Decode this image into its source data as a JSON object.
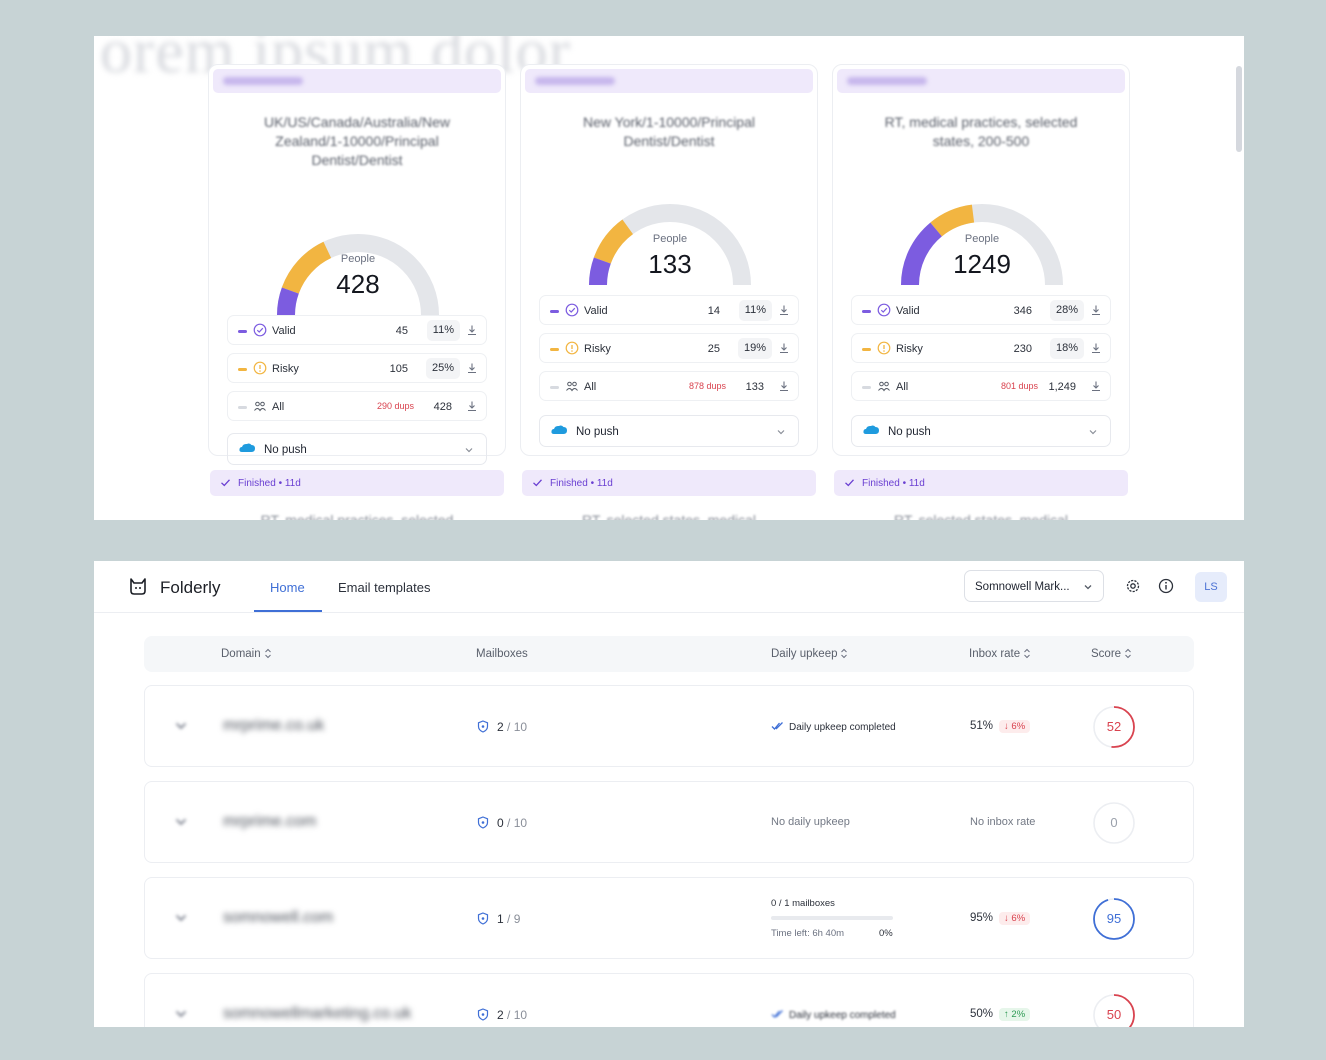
{
  "segments_panel": {
    "ghost_heading": "orem ipsum dolor",
    "cards": [
      {
        "tag": "Finished · 11d",
        "title_line1": "UK/US/Canada/Australia/New",
        "title_line2": "Zealand/1-10000/Principal",
        "title_line3": "Dentist/Dentist",
        "gauge_label": "People",
        "total": "428",
        "gauge": {
          "valid_fraction": 0.11,
          "risky_fraction": 0.25
        },
        "stats": [
          {
            "name": "Valid",
            "count": "45",
            "pct": "11%"
          },
          {
            "name": "Risky",
            "count": "105",
            "pct": "25%"
          },
          {
            "name": "All",
            "dups": "290 dups",
            "count": "428"
          }
        ],
        "push": "No push"
      },
      {
        "tag": "Finished · 11d",
        "title_line1": "New York/1-10000/Principal",
        "title_line2": "Dentist/Dentist",
        "gauge_label": "People",
        "total": "133",
        "gauge": {
          "valid_fraction": 0.11,
          "risky_fraction": 0.19
        },
        "stats": [
          {
            "name": "Valid",
            "count": "14",
            "pct": "11%"
          },
          {
            "name": "Risky",
            "count": "25",
            "pct": "19%"
          },
          {
            "name": "All",
            "dups": "878 dups",
            "count": "133"
          }
        ],
        "push": "No push"
      },
      {
        "tag": "Finished · 11d",
        "title_line1": "RT, medical practices, selected",
        "title_line2": "states, 200-500",
        "gauge_label": "People",
        "total": "1249",
        "gauge": {
          "valid_fraction": 0.28,
          "risky_fraction": 0.18
        },
        "stats": [
          {
            "name": "Valid",
            "count": "346",
            "pct": "28%"
          },
          {
            "name": "Risky",
            "count": "230",
            "pct": "18%"
          },
          {
            "name": "All",
            "dups": "801 dups",
            "count": "1,249"
          }
        ],
        "push": "No push"
      }
    ],
    "finished_tags": [
      "Finished • 11d",
      "Finished • 11d",
      "Finished • 11d"
    ],
    "cut_texts": [
      "RT, medical practices, selected",
      "RT, selected states, medical",
      "RT, selected states, medical"
    ]
  },
  "app": {
    "brand": "Folderly",
    "tabs": [
      "Home",
      "Email templates"
    ],
    "workspace": "Somnowell Mark...",
    "avatar": "LS",
    "icons": {
      "logo": "cat-logo-icon",
      "settings": "gear-icon",
      "info": "info-icon"
    },
    "accent_color": "#3f6fd6"
  },
  "table": {
    "headers": {
      "domain": "Domain",
      "mailboxes": "Mailboxes",
      "upkeep": "Daily upkeep",
      "inbox": "Inbox rate",
      "score": "Score"
    },
    "rows": [
      {
        "domain": "mrprime.co.uk",
        "mailboxes_used": "2",
        "mailboxes_total": "/ 10",
        "upkeep": "Daily upkeep completed",
        "inbox": "51%",
        "delta": "↓ 6%",
        "delta_dir": "down",
        "score": "52",
        "score_color": "#d9434f"
      },
      {
        "domain": "mrprime.com",
        "mailboxes_used": "0",
        "mailboxes_total": "/ 10",
        "upkeep": "No daily upkeep",
        "inbox": "No inbox rate",
        "score": "0",
        "score_color": "#9aa0ab"
      },
      {
        "domain": "somnowell.com",
        "mailboxes_used": "1",
        "mailboxes_total": "/ 9",
        "upkeep_progress_label": "0 / 1 mailboxes",
        "upkeep_progress": 0,
        "upkeep_time": "Time left: 6h 40m",
        "upkeep_pct": "0%",
        "inbox": "95%",
        "delta": "↓ 6%",
        "delta_dir": "down",
        "score": "95",
        "score_color": "#3f6fd6"
      },
      {
        "domain": "somnowellmarketing.co.uk",
        "mailboxes_used": "2",
        "mailboxes_total": "/ 10",
        "upkeep": "Daily upkeep completed",
        "inbox": "50%",
        "delta": "↑ 2%",
        "delta_dir": "up",
        "score": "50",
        "score_color": "#d9434f"
      }
    ]
  }
}
